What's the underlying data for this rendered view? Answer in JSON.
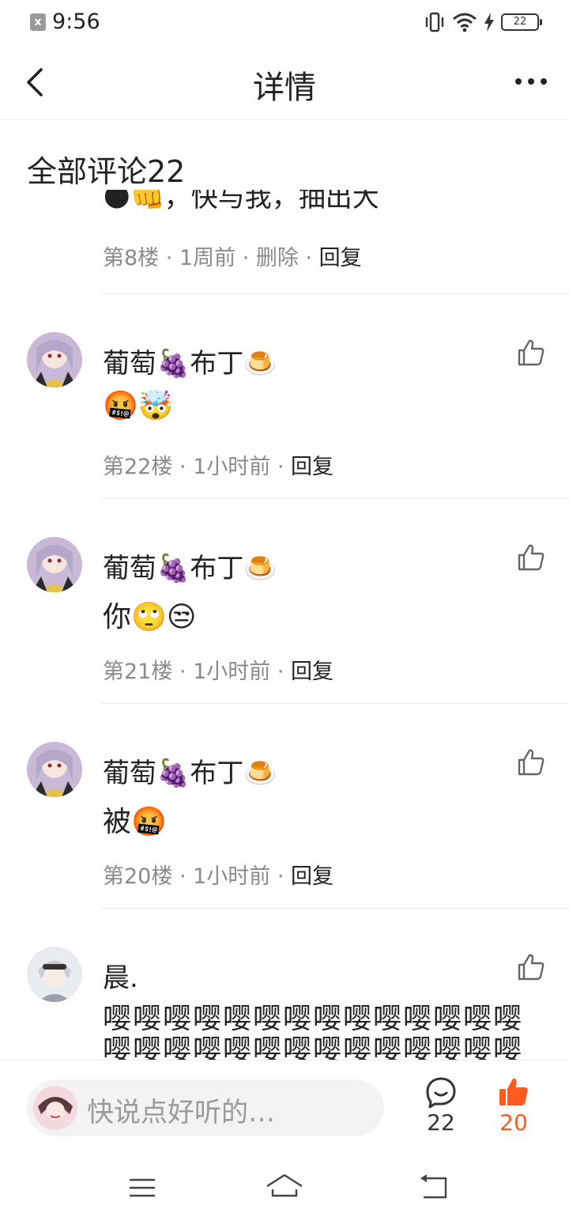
{
  "status_bar": {
    "time": "9:56",
    "battery": "22",
    "x_badge": "x"
  },
  "header": {
    "title": "详情"
  },
  "section": {
    "title": "全部评论22"
  },
  "partial_comment": {
    "text": "🌑👊，快与我，抽出大",
    "floor": "第8楼",
    "time": "1周前",
    "delete": "删除",
    "reply": "回复"
  },
  "separator": " · ",
  "comments": [
    {
      "username": "葡萄🍇布丁🍮",
      "body": "🤬🤯",
      "floor": "第22楼",
      "time": "1小时前",
      "reply": "回复"
    },
    {
      "username": "葡萄🍇布丁🍮",
      "body": "你🙄😒",
      "floor": "第21楼",
      "time": "1小时前",
      "reply": "回复"
    },
    {
      "username": "葡萄🍇布丁🍮",
      "body": "被🤬",
      "floor": "第20楼",
      "time": "1小时前",
      "reply": "回复"
    },
    {
      "username": "晨.",
      "body": "嘤嘤嘤嘤嘤嘤嘤嘤嘤嘤嘤嘤嘤嘤嘤嘤嘤嘤嘤嘤嘤嘤嘤嘤嘤嘤嘤嘤",
      "floor": "",
      "time": "",
      "reply": ""
    }
  ],
  "input_bar": {
    "placeholder": "快说点好听的…",
    "comment_count": "22",
    "like_count": "20"
  },
  "colors": {
    "accent": "#ff5a1f",
    "muted": "#8a8a8a",
    "divider": "#ebebeb"
  }
}
